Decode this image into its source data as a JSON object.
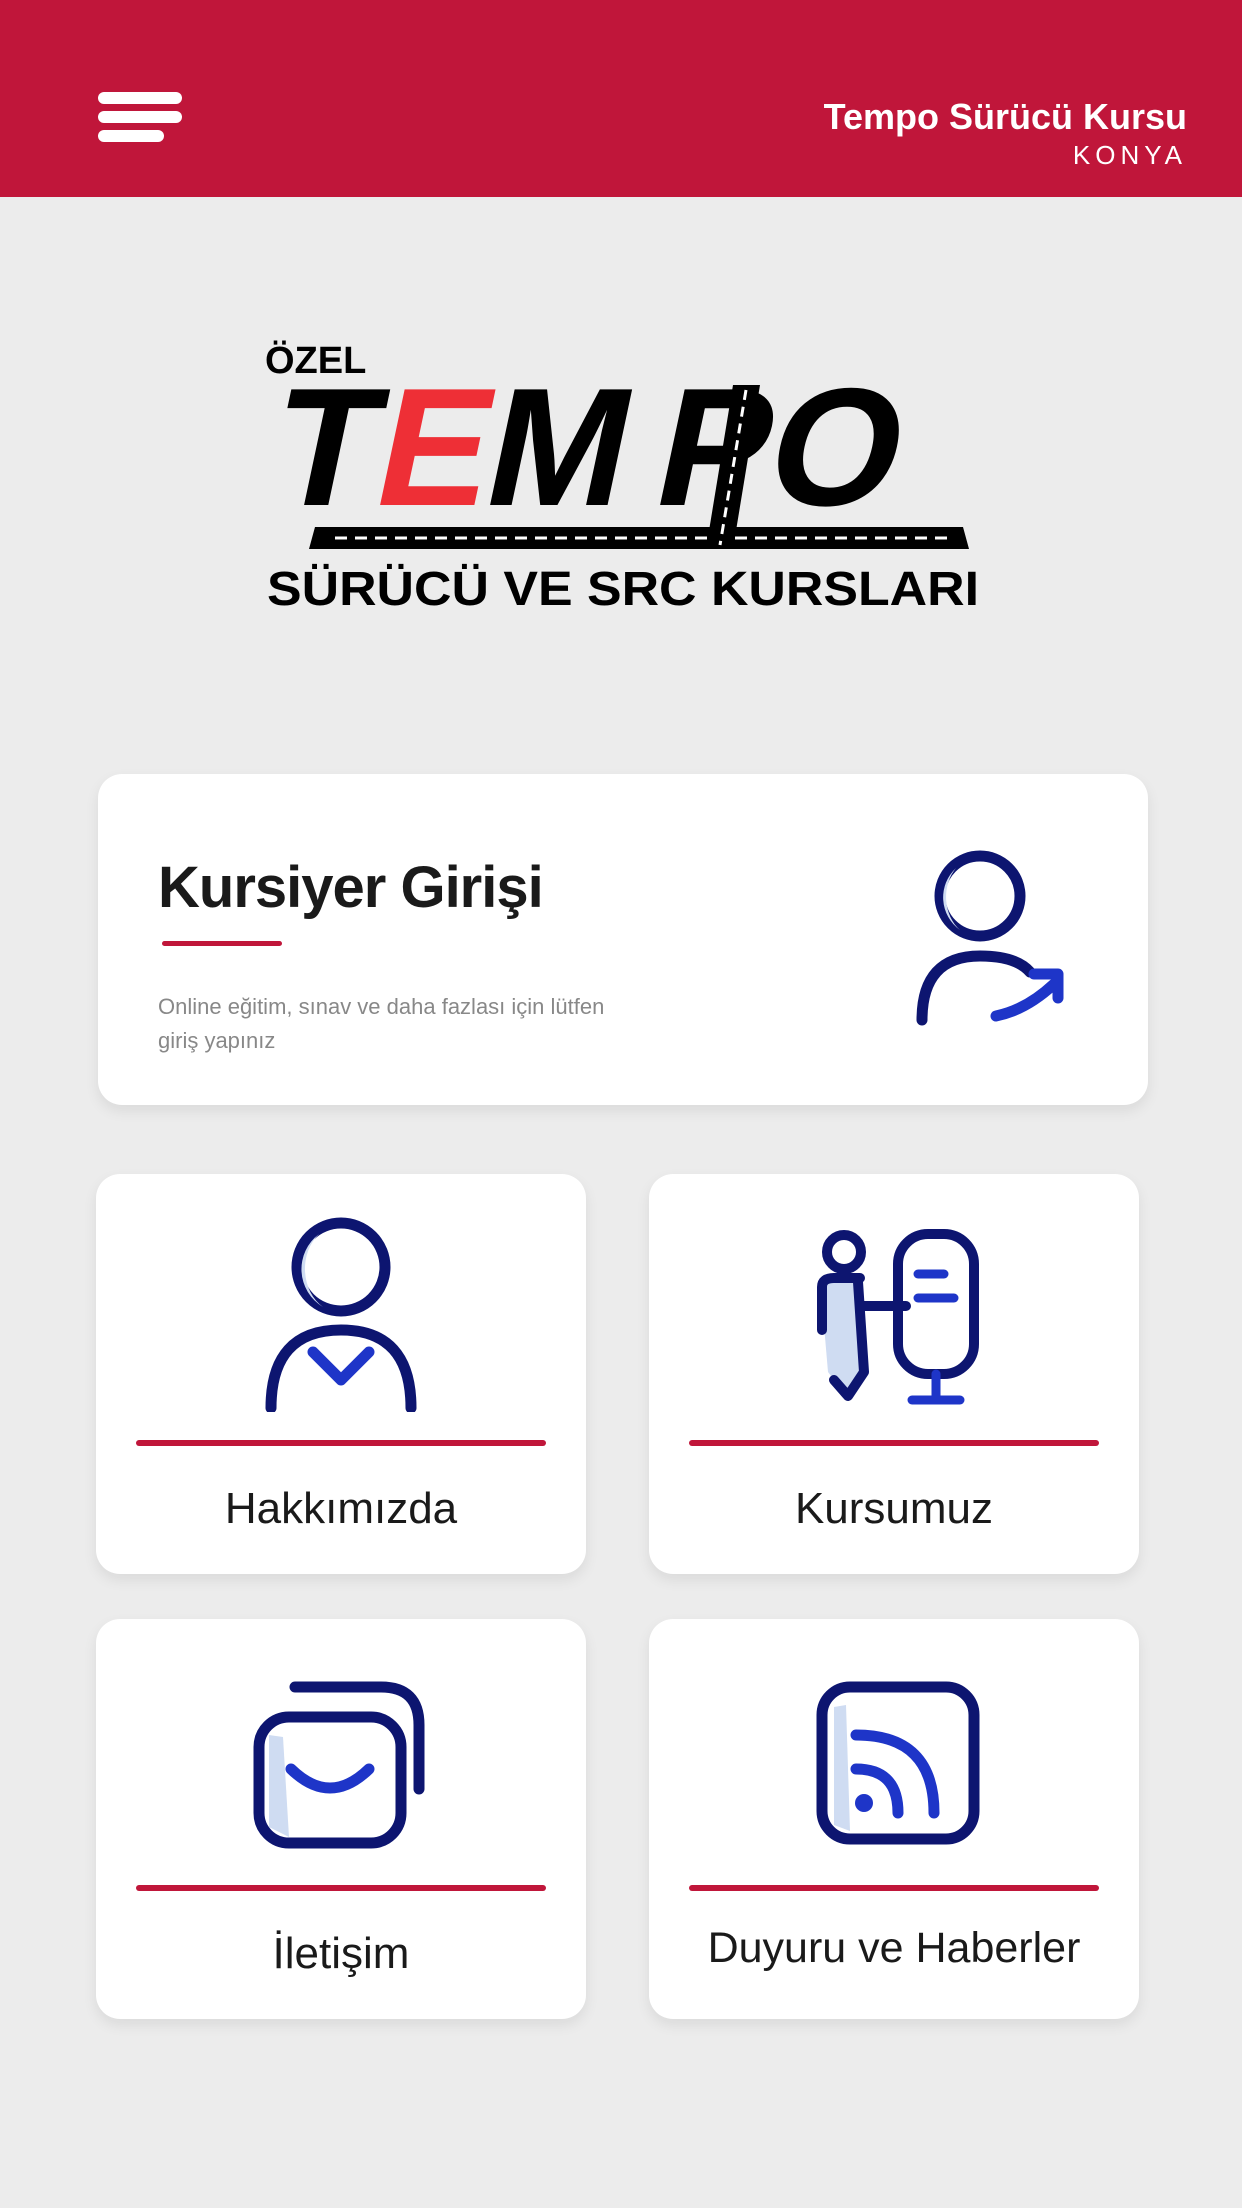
{
  "header": {
    "title": "Tempo Sürücü Kursu",
    "subtitle": "KONYA",
    "menu_icon": "hamburger-menu-icon",
    "bg_color": "#c0163a"
  },
  "logo": {
    "prefix": "ÖZEL",
    "brand_part1": "T",
    "brand_part2": "E",
    "brand_part3": "M",
    "brand_part4": "PO",
    "tagline": "SÜRÜCÜ VE SRC KURSLARI",
    "accent_color": "#ee2f36"
  },
  "login_card": {
    "title": "Kursiyer Girişi",
    "description": "Online eğitim, sınav ve daha fazlası için lütfen giriş yapınız",
    "icon": "user-login-icon"
  },
  "tiles": [
    {
      "label": "Hakkımızda",
      "icon": "user-about-icon"
    },
    {
      "label": "Kursumuz",
      "icon": "instructor-board-icon"
    },
    {
      "label": "İletişim",
      "icon": "mail-contact-icon"
    },
    {
      "label": "Duyuru ve Haberler",
      "icon": "rss-news-icon"
    }
  ],
  "colors": {
    "primary": "#c0163a",
    "icon_dark": "#0d1570",
    "icon_accent": "#1e35c8",
    "icon_light": "#cfdcf2",
    "background": "#ececec"
  }
}
